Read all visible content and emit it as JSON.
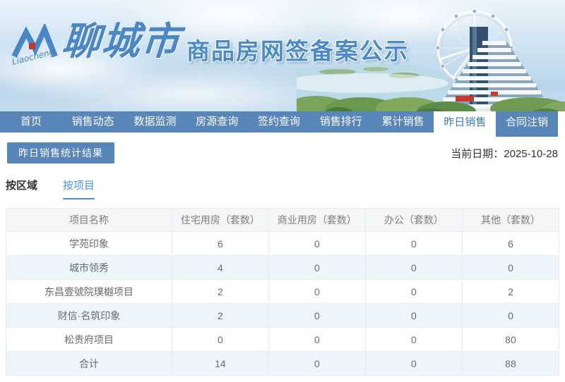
{
  "banner": {
    "logo_text": "Liaocheng",
    "city": "聊城市",
    "title": "商品房网签备案公示"
  },
  "nav": {
    "items": [
      {
        "label": "首页"
      },
      {
        "label": "销售动态"
      },
      {
        "label": "数据监测"
      },
      {
        "label": "房源查询"
      },
      {
        "label": "签约查询"
      },
      {
        "label": "销售排行"
      },
      {
        "label": "累计销售"
      },
      {
        "label": "昨日销售",
        "active": true
      },
      {
        "label": "合同注销"
      }
    ]
  },
  "toolbar": {
    "result_button": "昨日销售统计结果",
    "date_label": "当前日期：",
    "date_value": "2025-10-28"
  },
  "view_tabs": {
    "items": [
      {
        "label": "按区域"
      },
      {
        "label": "按项目",
        "active": true
      }
    ]
  },
  "table": {
    "columns": [
      "项目名称",
      "住宅用房（套数）",
      "商业用房（套数）",
      "办公（套数）",
      "其他（套数）"
    ],
    "rows": [
      {
        "name": "学苑印象",
        "values": [
          "6",
          "0",
          "0",
          "6"
        ]
      },
      {
        "name": "城市领秀",
        "values": [
          "4",
          "0",
          "0",
          "0"
        ]
      },
      {
        "name": "东昌壹號院璞樾项目",
        "values": [
          "2",
          "0",
          "0",
          "2"
        ]
      },
      {
        "name": "财信·名筑印象",
        "values": [
          "2",
          "0",
          "0",
          "0"
        ]
      },
      {
        "name": "松贵府项目",
        "values": [
          "0",
          "0",
          "0",
          "80"
        ]
      },
      {
        "name": "合计",
        "values": [
          "14",
          "0",
          "0",
          "88"
        ]
      }
    ]
  },
  "colors": {
    "nav_blue": "#5886b8",
    "accent_blue": "#4a90e2",
    "title_blue": "#4b8ac9",
    "stripe_blue": "#edf6fb",
    "logo_red": "#c0392b"
  }
}
